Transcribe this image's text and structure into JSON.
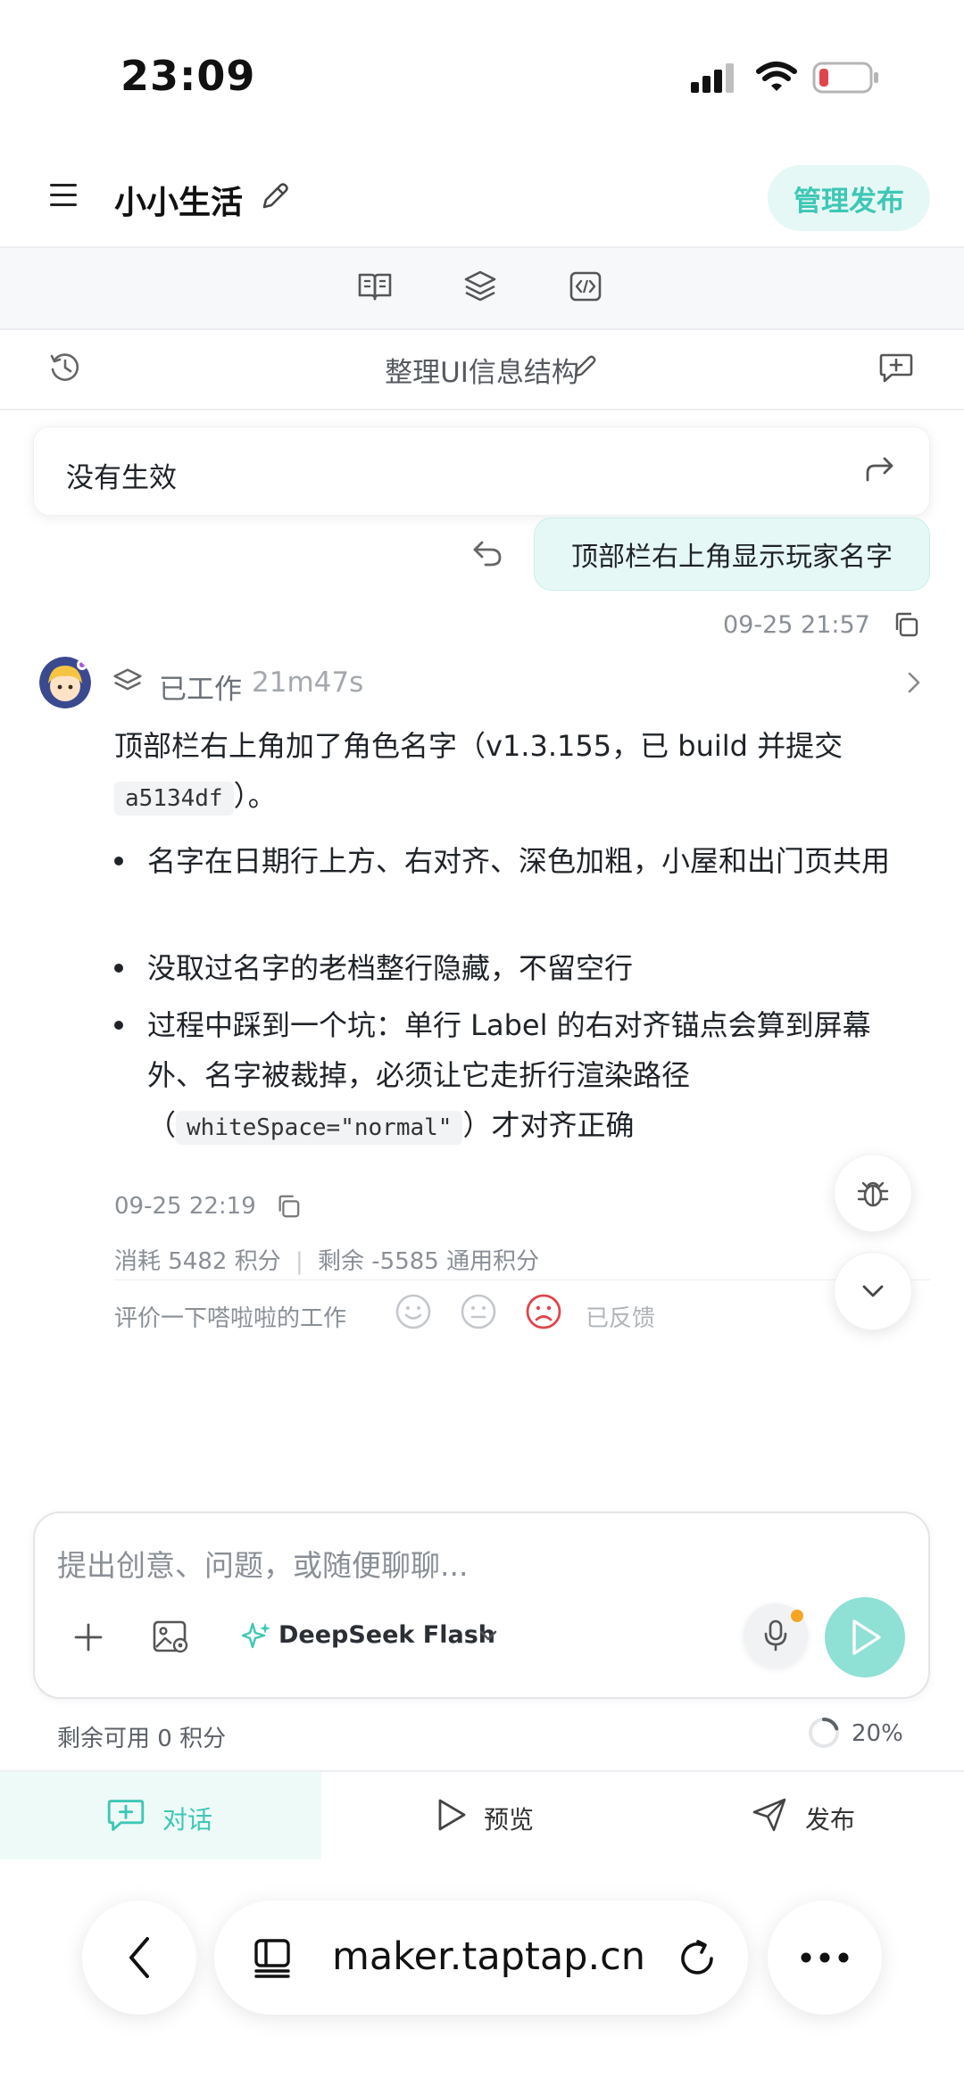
{
  "status_bar": {
    "time": "23:09"
  },
  "header": {
    "title": "小小生活",
    "manage_publish": "管理发布"
  },
  "thread": {
    "title": "整理UI信息结构"
  },
  "quote": {
    "text": "没有生效"
  },
  "user_message": {
    "text": "顶部栏右上角显示玩家名字",
    "time": "09-25 21:57"
  },
  "assistant": {
    "worked_label": "已工作",
    "worked_duration": "21m47s",
    "intro_before_code": "顶部栏右上角加了角色名字（v1.3.155，已 build 并提交",
    "intro_code": "a5134df",
    "intro_after_code": "）。",
    "bullet_1": "名字在日期行上方、右对齐、深色加粗，小屋和出门页共用",
    "bullet_2": "没取过名字的老档整行隐藏，不留空行",
    "bullet_3_before": "过程中踩到一个坑：单行 Label 的右对齐锚点会算到屏幕外、名字被裁掉，必须让它走折行渲染路径",
    "bullet_3_paren_open": "（",
    "bullet_3_code": "whiteSpace=\"normal\"",
    "bullet_3_after": "）才对齐正确",
    "time": "09-25 22:19",
    "consumed": "消耗 5482 积分",
    "separator": "|",
    "remaining": "剩余 -5585 通用积分",
    "rate_prompt": "评价一下嗒啦啦的工作",
    "feedback_state": "已反馈"
  },
  "composer": {
    "placeholder": "提出创意、问题，或随便聊聊...",
    "model": "DeepSeek Flash",
    "credits": "剩余可用 0 积分",
    "context_percent": "20%"
  },
  "tabs": [
    {
      "label": "对话"
    },
    {
      "label": "预览"
    },
    {
      "label": "发布"
    }
  ],
  "browser": {
    "url": "maker.taptap.cn"
  },
  "colors": {
    "accent": "#3ec7b5",
    "accent_light": "#e6f8f5",
    "negative": "#e0454d"
  }
}
